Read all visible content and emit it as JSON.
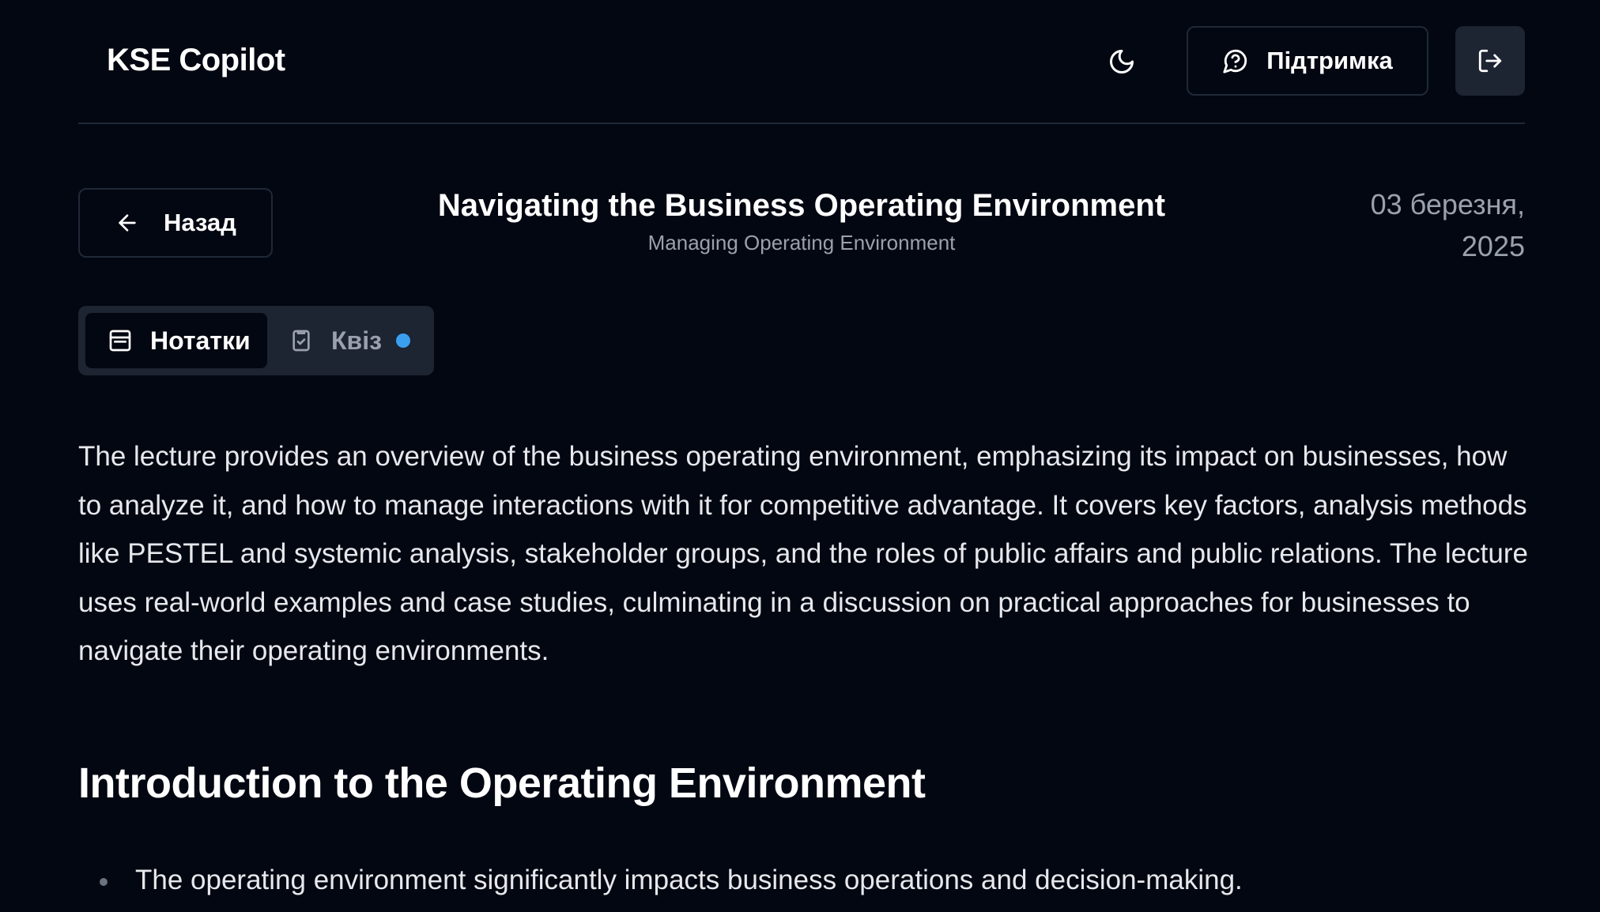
{
  "header": {
    "brand": "KSE Copilot",
    "theme_toggle_icon": "moon-icon",
    "support_label": "Підтримка",
    "support_icon": "message-question-icon",
    "logout_icon": "log-out-icon"
  },
  "lecture": {
    "back_label": "Назад",
    "title": "Navigating the Business Operating Environment",
    "subtitle": "Managing Operating Environment",
    "date_line1": "03 березня,",
    "date_line2": "2025"
  },
  "tabs": [
    {
      "label": "Нотатки",
      "icon": "notebook-icon",
      "active": true
    },
    {
      "label": "Квіз",
      "icon": "clipboard-check-icon",
      "active": false,
      "indicator_color": "#3b9ff0"
    }
  ],
  "content": {
    "summary": "The lecture provides an overview of the business operating environment, emphasizing its impact on businesses, how to analyze it, and how to manage interactions with it for competitive advantage. It covers key factors, analysis methods like PESTEL and systemic analysis, stakeholder groups, and the roles of public affairs and public relations. The lecture uses real-world examples and case studies, culminating in a discussion on practical approaches for businesses to navigate their operating environments.",
    "section_heading": "Introduction to the Operating Environment",
    "bullets": [
      "The operating environment significantly impacts business operations and decision-making."
    ]
  },
  "colors": {
    "background": "#030711",
    "surface": "#1d2432",
    "border": "#1f2937",
    "muted_text": "#9aa1ad",
    "accent": "#3b9ff0"
  }
}
